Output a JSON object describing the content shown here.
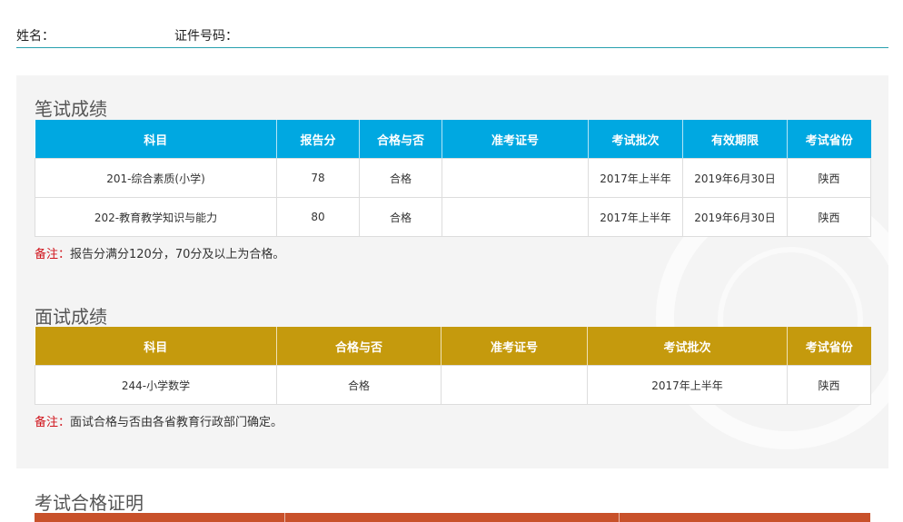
{
  "header": {
    "name_label": "姓名：",
    "id_label": "证件号码："
  },
  "written": {
    "title": "笔试成绩",
    "columns": [
      "科目",
      "报告分",
      "合格与否",
      "准考证号",
      "考试批次",
      "有效期限",
      "考试省份"
    ],
    "rows": [
      {
        "subject": "201-综合素质(小学)",
        "score": "78",
        "pass": "合格",
        "batch": "2017年上半年",
        "valid": "2019年6月30日",
        "province": "陕西"
      },
      {
        "subject": "202-教育教学知识与能力",
        "score": "80",
        "pass": "合格",
        "batch": "2017年上半年",
        "valid": "2019年6月30日",
        "province": "陕西"
      }
    ],
    "note_label": "备注：",
    "note_text": "报告分满分120分，70分及以上为合格。"
  },
  "interview": {
    "title": "面试成绩",
    "columns": [
      "科目",
      "合格与否",
      "准考证号",
      "考试批次",
      "考试省份"
    ],
    "rows": [
      {
        "subject": "244-小学数学",
        "pass": "合格",
        "batch": "2017年上半年",
        "province": "陕西"
      }
    ],
    "note_label": "备注：",
    "note_text": "面试合格与否由各省教育行政部门确定。"
  },
  "certificate": {
    "title": "考试合格证明"
  },
  "colors": {
    "written_header": "#00a8e1",
    "interview_header": "#c59a0d",
    "cert_header": "#c8512a",
    "note_label": "#d0131b",
    "divider": "#28a0ae"
  }
}
